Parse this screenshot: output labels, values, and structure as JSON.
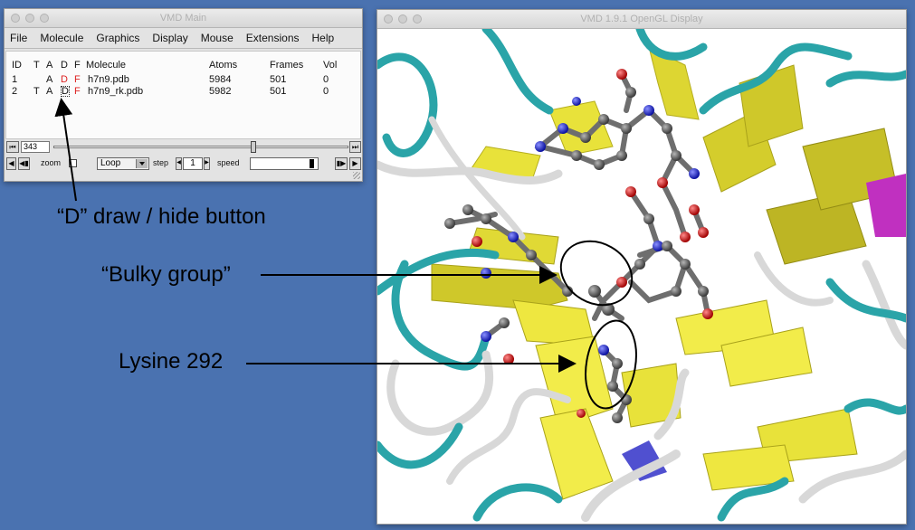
{
  "main_window": {
    "title": "VMD Main",
    "menu": [
      "File",
      "Molecule",
      "Graphics",
      "Display",
      "Mouse",
      "Extensions",
      "Help"
    ],
    "columns": {
      "id": "ID",
      "t": "T",
      "a": "A",
      "d": "D",
      "f": "F",
      "molecule": "Molecule",
      "atoms": "Atoms",
      "frames": "Frames",
      "vol": "Vol"
    },
    "molecules": [
      {
        "id": "1",
        "t": "",
        "a": "A",
        "d": "D",
        "f": "F",
        "name": "h7n9.pdb",
        "atoms": "5984",
        "frames": "501",
        "vol": "0"
      },
      {
        "id": "2",
        "t": "T",
        "a": "A",
        "d": "D",
        "f": "F",
        "name": "h7n9_rk.pdb",
        "atoms": "5982",
        "frames": "501",
        "vol": "0"
      }
    ],
    "animation": {
      "frame": "343",
      "frame_fraction": 0.68,
      "zoom_label": "zoom",
      "loop_mode": "Loop",
      "step_label": "step",
      "step_value": "1",
      "speed_label": "speed",
      "speed_fraction": 0.95
    }
  },
  "display_window": {
    "title": "VMD 1.9.1 OpenGL Display",
    "colors": {
      "background": "#ffffff",
      "sheet": "#e8e23a",
      "coil_teal": "#2aa4a8",
      "coil_white": "#d8d8d8",
      "carbon": "#6e6e6e",
      "oxygen": "#e02020",
      "nitrogen": "#2030d0",
      "helix_purple": "#c030c0"
    }
  },
  "annotations": {
    "d_button": "“D” draw / hide button",
    "bulky_group": "“Bulky group”",
    "lysine": "Lysine 292"
  }
}
